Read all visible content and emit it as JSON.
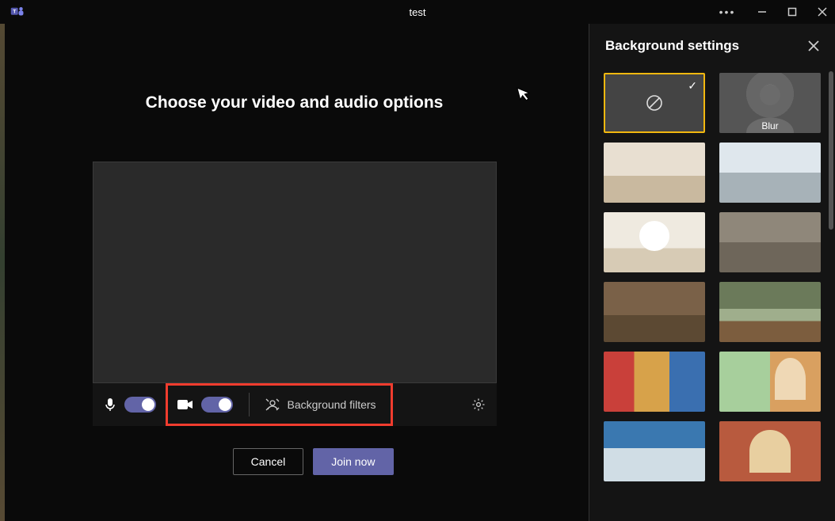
{
  "window": {
    "title": "test"
  },
  "main": {
    "heading": "Choose your video and audio options",
    "background_filters_label": "Background filters",
    "cancel_label": "Cancel",
    "join_label": "Join now"
  },
  "panel": {
    "title": "Background settings",
    "items": [
      {
        "kind": "none",
        "label": "",
        "selected": true
      },
      {
        "kind": "blur",
        "label": "Blur",
        "selected": false
      },
      {
        "kind": "image",
        "label": "",
        "style": "rm1"
      },
      {
        "kind": "image",
        "label": "",
        "style": "rm2"
      },
      {
        "kind": "image",
        "label": "",
        "style": "rm3"
      },
      {
        "kind": "image",
        "label": "",
        "style": "rm4"
      },
      {
        "kind": "image",
        "label": "",
        "style": "rm5"
      },
      {
        "kind": "image",
        "label": "",
        "style": "rm6"
      },
      {
        "kind": "image",
        "label": "",
        "style": "rm7"
      },
      {
        "kind": "image",
        "label": "",
        "style": "rm8"
      },
      {
        "kind": "image",
        "label": "",
        "style": "rm9"
      },
      {
        "kind": "image",
        "label": "",
        "style": "rm10"
      }
    ]
  },
  "colors": {
    "accent": "#6264a7",
    "highlight_border": "#f03c2e",
    "selection_border": "#f2b80f"
  }
}
